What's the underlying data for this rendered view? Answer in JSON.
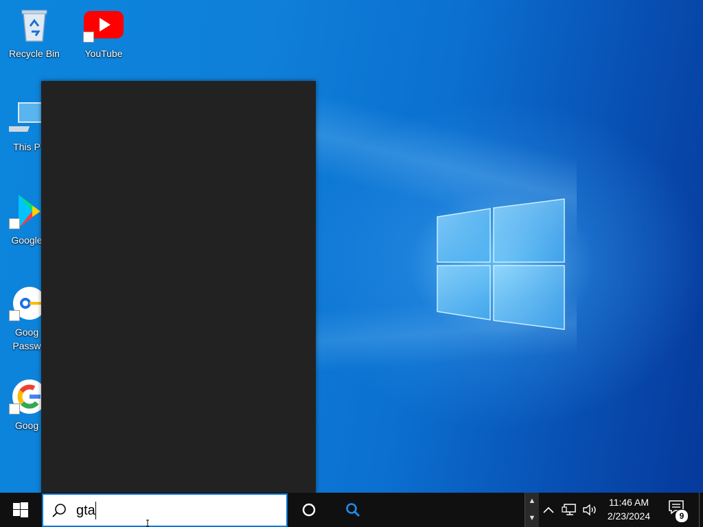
{
  "desktop": {
    "icons": [
      {
        "label": "Recycle Bin",
        "icon": "recycle-bin-icon"
      },
      {
        "label": "YouTube",
        "icon": "youtube-icon"
      },
      {
        "label": "This P",
        "icon": "computer-icon"
      },
      {
        "label": "Google",
        "icon": "google-play-icon"
      },
      {
        "label": "Goog\nPassw",
        "icon": "google-password-icon"
      },
      {
        "label": "Goog",
        "icon": "google-icon"
      }
    ]
  },
  "search_flyout": {
    "content": ""
  },
  "taskbar": {
    "start_icon": "windows-start-icon",
    "search": {
      "value": "gta",
      "placeholder": ""
    },
    "cortana_icon": "cortana-circle-icon",
    "search_app_icon": "magnifier-icon",
    "tray": {
      "chevron_icon": "chevron-up-icon",
      "network_icon": "network-icon",
      "volume_icon": "volume-icon"
    },
    "clock": {
      "time": "11:46 AM",
      "date": "2/23/2024"
    },
    "notifications": {
      "count": "9",
      "icon": "action-center-icon"
    }
  },
  "colors": {
    "accent": "#0a78d7",
    "taskbar": "#101010",
    "flyout": "#222222"
  }
}
